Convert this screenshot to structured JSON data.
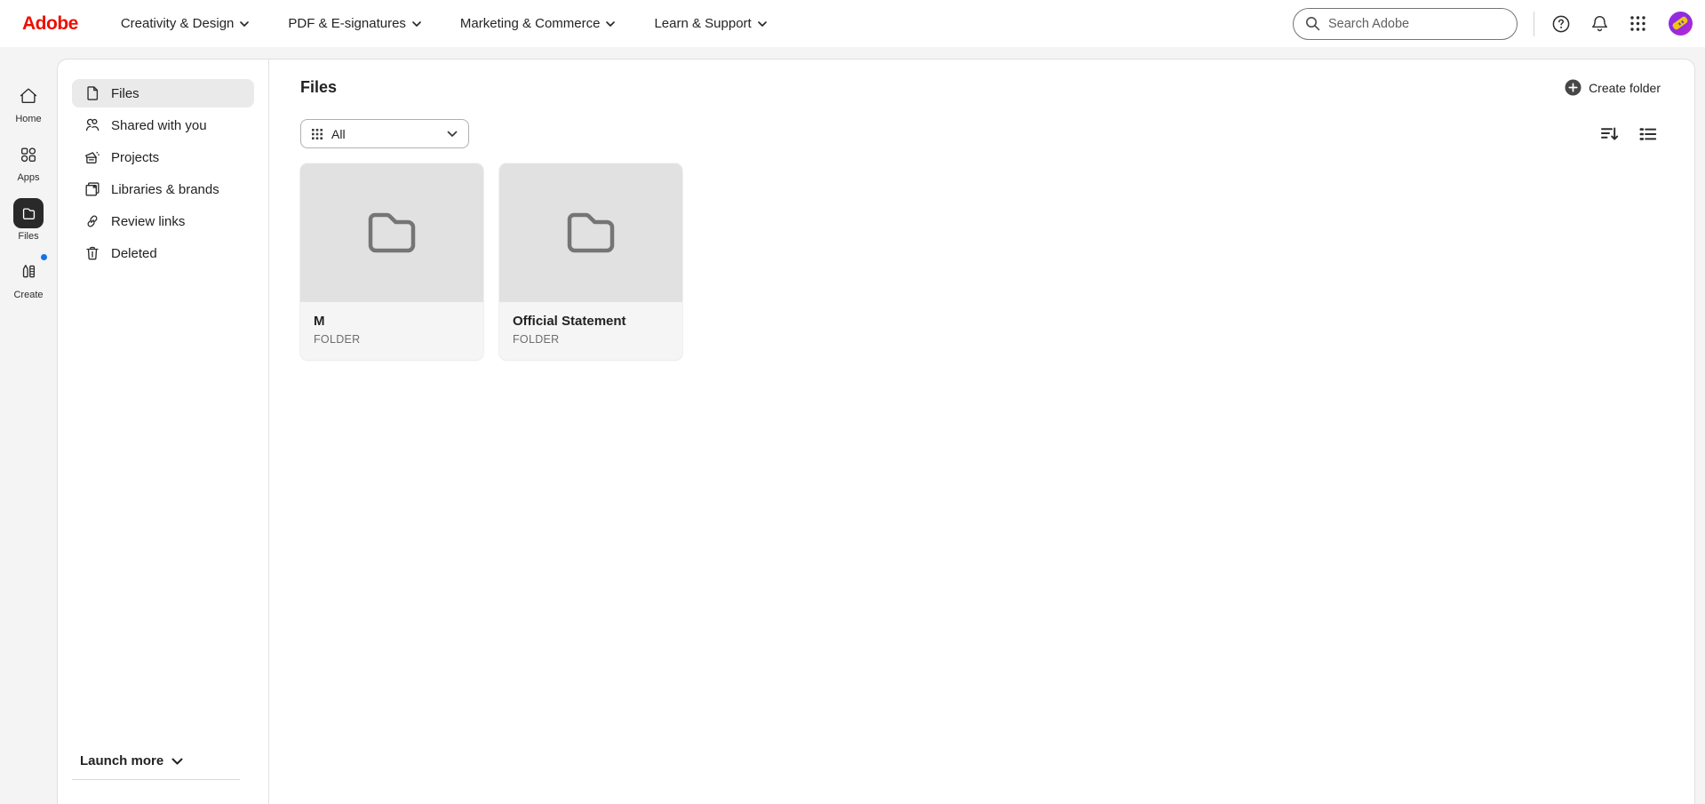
{
  "topnav": {
    "logo": "Adobe",
    "menus": [
      {
        "label": "Creativity & Design"
      },
      {
        "label": "PDF & E-signatures"
      },
      {
        "label": "Marketing & Commerce"
      },
      {
        "label": "Learn & Support"
      }
    ],
    "search_placeholder": "Search Adobe"
  },
  "rail": {
    "items": [
      {
        "label": "Home"
      },
      {
        "label": "Apps"
      },
      {
        "label": "Files"
      },
      {
        "label": "Create"
      }
    ]
  },
  "sidebar": {
    "items": [
      {
        "label": "Files"
      },
      {
        "label": "Shared with you"
      },
      {
        "label": "Projects"
      },
      {
        "label": "Libraries & brands"
      },
      {
        "label": "Review links"
      },
      {
        "label": "Deleted"
      }
    ],
    "launch_more": "Launch more"
  },
  "main": {
    "title": "Files",
    "create_folder_label": "Create folder",
    "filter": {
      "value": "All"
    },
    "cards": [
      {
        "name": "M",
        "type": "FOLDER"
      },
      {
        "name": "Official Statement",
        "type": "FOLDER"
      }
    ]
  },
  "colors": {
    "logo_red": "#EB1000",
    "create_badge_blue": "#1473E6",
    "thumbnail_gray": "#E1E1E1",
    "panel_border": "#E0E0E0",
    "active_row_gray": "#EAEAEA"
  }
}
